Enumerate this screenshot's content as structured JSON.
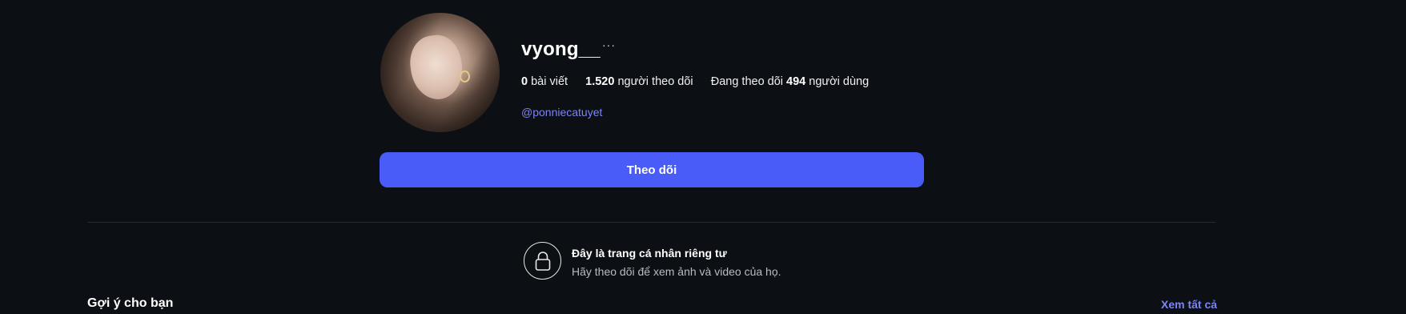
{
  "profile": {
    "username": "vyong__",
    "more_label": "···",
    "stats": {
      "posts_count": "0",
      "posts_label": "bài viết",
      "followers_count": "1.520",
      "followers_label": "người theo dõi",
      "following_prefix": "Đang theo dõi",
      "following_count": "494",
      "following_label": "người dùng"
    },
    "mention": "@ponniecatuyet",
    "follow_button": "Theo dõi"
  },
  "private_notice": {
    "title": "Đây là trang cá nhân riêng tư",
    "subtitle": "Hãy theo dõi để xem ảnh và video của họ.",
    "icon": "lock-icon"
  },
  "suggestions": {
    "title": "Gợi ý cho bạn",
    "see_all": "Xem tất cả"
  },
  "colors": {
    "background": "#0c0f14",
    "accent": "#4a5cf7",
    "link": "#7d84f5"
  }
}
